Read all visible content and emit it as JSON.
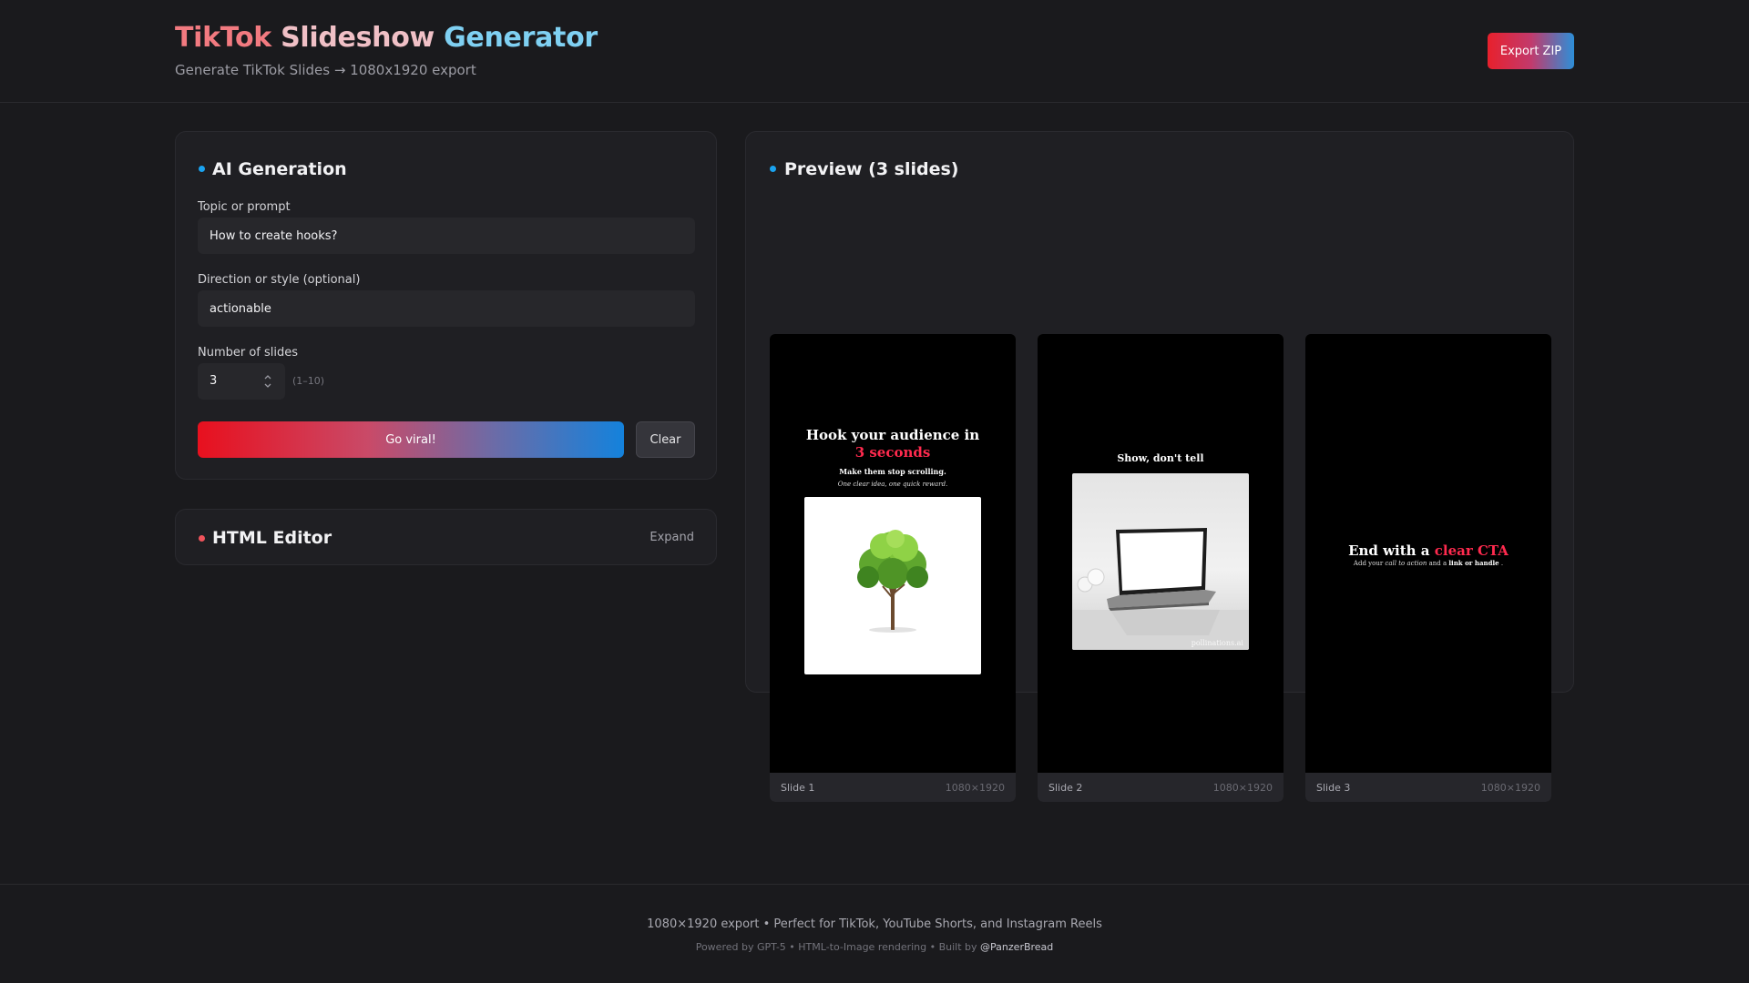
{
  "header": {
    "title_word1": "TikTok",
    "title_word2": "Slideshow",
    "title_word3": "Generator",
    "subtitle": "Generate TikTok Slides → 1080x1920 export",
    "export_label": "Export ZIP"
  },
  "ai_panel": {
    "title": "AI Generation",
    "dot_color": "#1aa3f0",
    "topic_label": "Topic or prompt",
    "topic_value": "How to create hooks?",
    "direction_label": "Direction or style (optional)",
    "direction_value": "actionable",
    "slides_label": "Number of slides",
    "slides_value": "3",
    "slides_hint": "(1–10)",
    "generate_label": "Go viral!",
    "clear_label": "Clear"
  },
  "editor_panel": {
    "title": "HTML Editor",
    "dot_color": "#f0535b",
    "expand_label": "Expand"
  },
  "preview": {
    "title": "Preview (3 slides)",
    "dot_color": "#1aa3f0",
    "slides": [
      {
        "label": "Slide 1",
        "size": "1080×1920",
        "headline": "Hook your audience in",
        "highlight": "3 seconds",
        "subline": "Make them stop scrolling.",
        "note": "One clear idea, one quick reward."
      },
      {
        "label": "Slide 2",
        "size": "1080×1920",
        "title": "Show, don't tell",
        "watermark": "pollinations.ai"
      },
      {
        "label": "Slide 3",
        "size": "1080×1920",
        "headline_part1": "End with a",
        "headline_highlight": "clear CTA",
        "sub_part1": "Add your",
        "sub_em": "call to action",
        "sub_part2": "and a",
        "sub_bold": "link or handle",
        "sub_end": "."
      }
    ]
  },
  "colors": {
    "accent_red": "#ff2a4e",
    "accent_blue": "#1482dc",
    "background": "#1a1a1d"
  },
  "footer": {
    "main": "1080×1920 export • Perfect for TikTok, YouTube Shorts, and Instagram Reels",
    "credits_prefix": "Powered by GPT-5 • HTML-to-Image rendering • Built by",
    "credits_handle": "@PanzerBread"
  }
}
